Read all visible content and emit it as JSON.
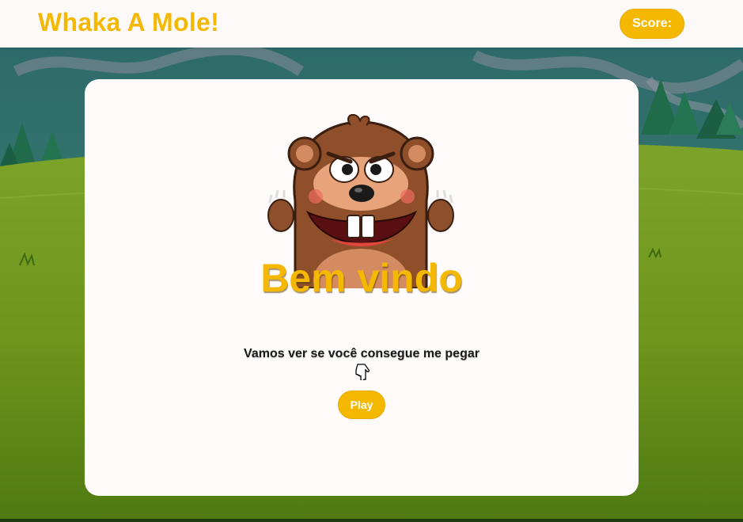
{
  "header": {
    "title": "Whaka A Mole!",
    "score_label": "Score:"
  },
  "welcome_card": {
    "heading": "Bem vindo",
    "subtitle": "Vamos ver se você consegue me pegar",
    "play_label": "Play"
  },
  "icons": {
    "mascot": "mole-mascot-icon",
    "pointer": "pointing-hand-icon"
  },
  "colors": {
    "accent": "#f5b800",
    "header_bg": "#fdf9f9",
    "card_bg": "#fffbfb",
    "sky": "#2d6e6c",
    "grass": "#6f9a1f"
  }
}
